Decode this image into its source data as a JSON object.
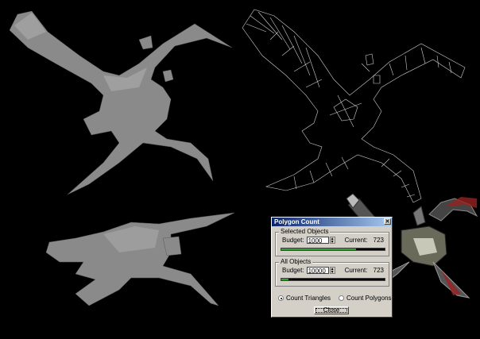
{
  "viewport": {
    "description_icons": [
      "shaded-creature-model",
      "wireframe-creature-model",
      "textured-creature-model"
    ]
  },
  "dialog": {
    "title": "Polygon Count",
    "selected_group": {
      "label": "Selected Objects",
      "budget_label": "Budget:",
      "budget_value": "1000",
      "current_label": "Current:",
      "current_value": "723",
      "progress_fraction": 0.72
    },
    "all_group": {
      "label": "All Objects",
      "budget_label": "Budget:",
      "budget_value": "10000",
      "current_label": "Current:",
      "current_value": "723",
      "progress_fraction": 0.07
    },
    "radio_triangles": "Count Triangles",
    "radio_polygons": "Count Polygons",
    "close_button": "Close"
  },
  "colors": {
    "background": "#000000",
    "model_shaded": "#8a8a8a",
    "wireframe": "#cfcfcf",
    "progress": "#2ea12e"
  }
}
